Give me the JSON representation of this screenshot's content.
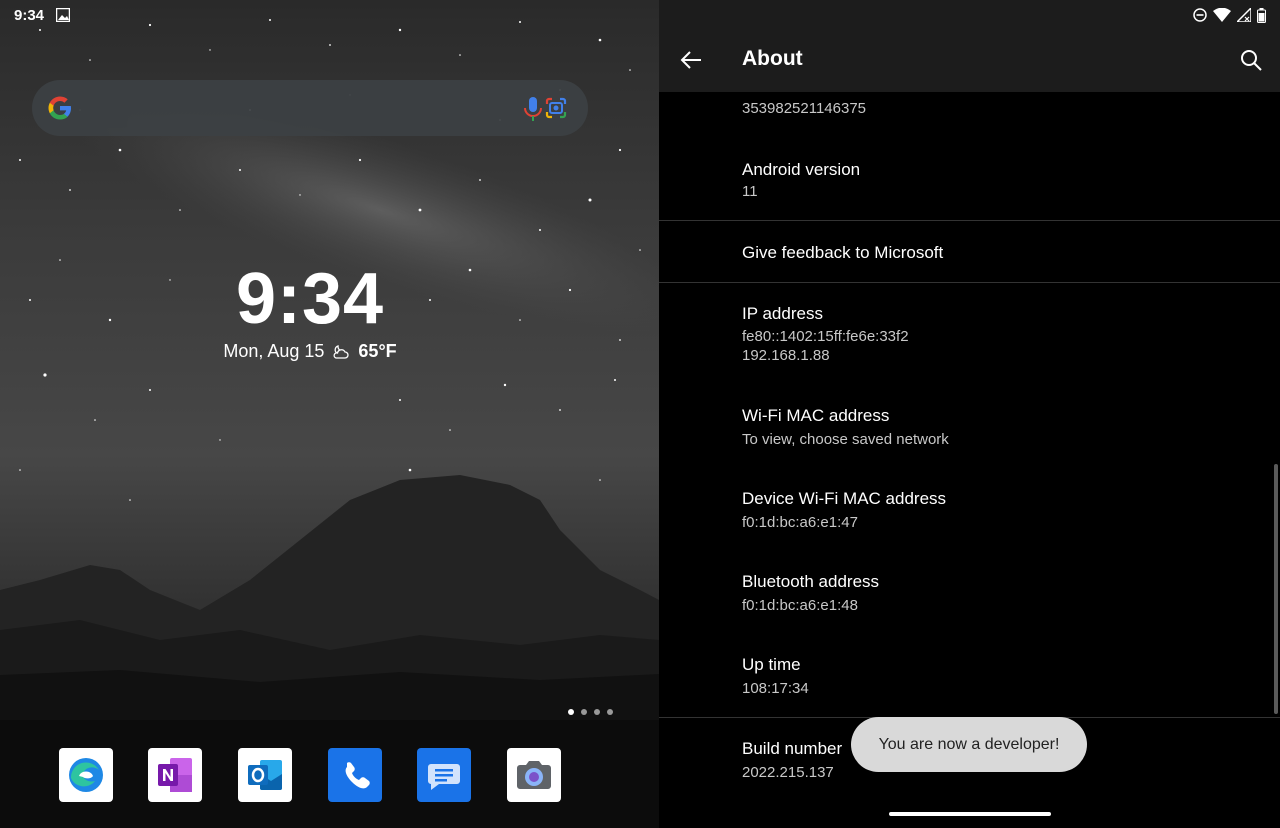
{
  "home": {
    "status_time": "9:34",
    "clock_time": "9:34",
    "date": "Mon, Aug 15",
    "temperature": "65°F",
    "page_count": 4,
    "active_page": 0,
    "dock_apps": [
      {
        "name": "Microsoft Edge",
        "icon": "edge-icon"
      },
      {
        "name": "OneNote",
        "icon": "onenote-icon"
      },
      {
        "name": "Outlook",
        "icon": "outlook-icon"
      },
      {
        "name": "Phone",
        "icon": "phone-icon"
      },
      {
        "name": "Messages",
        "icon": "messages-icon"
      },
      {
        "name": "Camera",
        "icon": "camera-icon"
      }
    ]
  },
  "settings": {
    "title": "About",
    "rows": [
      {
        "title": "",
        "subtitle": "353982521146375"
      },
      {
        "title": "Android version",
        "subtitle": "11"
      },
      {
        "title": "Give feedback to Microsoft",
        "subtitle": ""
      },
      {
        "title": "IP address",
        "subtitle": "fe80::1402:15ff:fe6e:33f2",
        "subtitle2": "192.168.1.88"
      },
      {
        "title": "Wi-Fi MAC address",
        "subtitle": "To view, choose saved network"
      },
      {
        "title": "Device Wi-Fi MAC address",
        "subtitle": "f0:1d:bc:a6:e1:47"
      },
      {
        "title": "Bluetooth address",
        "subtitle": "f0:1d:bc:a6:e1:48"
      },
      {
        "title": "Up time",
        "subtitle": "108:17:34"
      },
      {
        "title": "Build number",
        "subtitle": "2022.215.137"
      }
    ],
    "toast": "You are now a developer!"
  },
  "colors": {
    "appbar": "#1c1c1c",
    "toast_bg": "#d9d9d9",
    "phone_blue": "#1a73e8",
    "onenote_purple": "#7719aa",
    "outlook_blue": "#0f6cbd"
  }
}
